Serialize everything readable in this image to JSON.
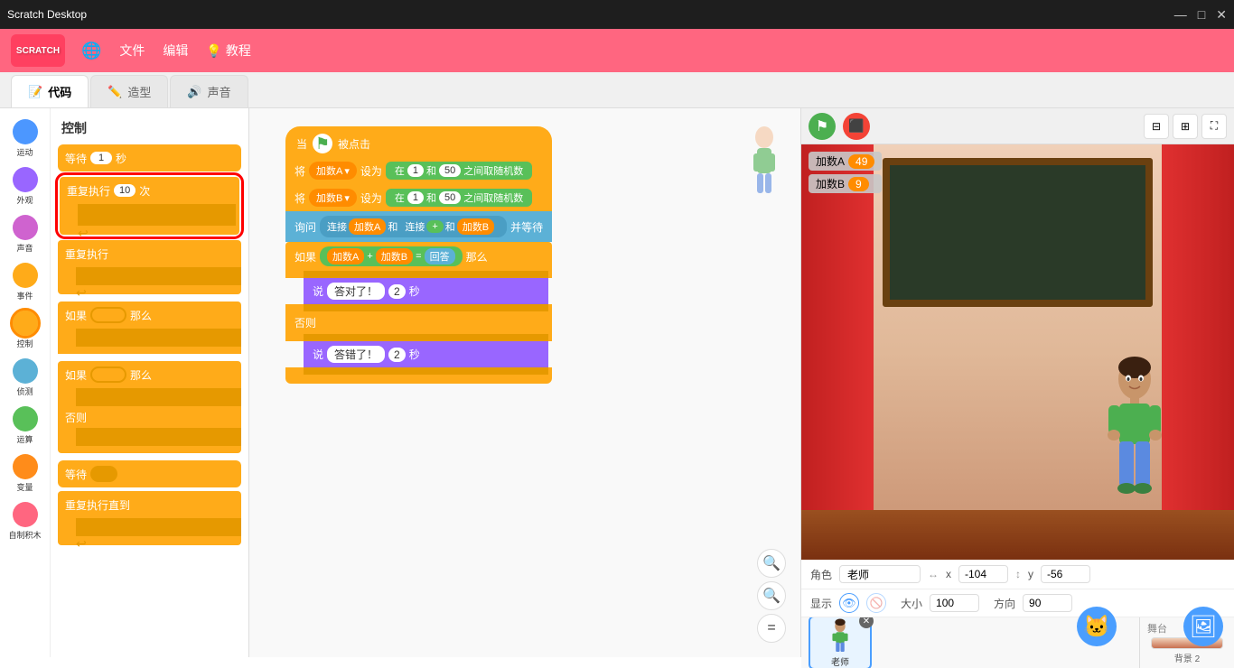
{
  "window": {
    "title": "Scratch Desktop"
  },
  "titlebar": {
    "title": "Scratch Desktop",
    "minimize": "—",
    "maximize": "□",
    "close": "✕"
  },
  "menubar": {
    "logo": "SCRATCH",
    "globe": "🌐",
    "file": "文件",
    "edit": "编辑",
    "tutorial_icon": "💡",
    "tutorial": "教程"
  },
  "tabs": {
    "code": "代码",
    "costume": "造型",
    "sound": "声音"
  },
  "categories": [
    {
      "id": "motion",
      "label": "运动",
      "color": "#4c97ff"
    },
    {
      "id": "looks",
      "label": "外观",
      "color": "#9966ff"
    },
    {
      "id": "sound",
      "label": "声音",
      "color": "#cf63cf"
    },
    {
      "id": "events",
      "label": "事件",
      "color": "#ffab19"
    },
    {
      "id": "control",
      "label": "控制",
      "color": "#ffab19",
      "active": true
    },
    {
      "id": "sensing",
      "label": "侦测",
      "color": "#5cb1d6"
    },
    {
      "id": "operators",
      "label": "运算",
      "color": "#59c059"
    },
    {
      "id": "variables",
      "label": "变量",
      "color": "#ff8c1a"
    },
    {
      "id": "myblocks",
      "label": "自制积木",
      "color": "#ff6680"
    }
  ],
  "blocks_panel": {
    "title": "控制",
    "blocks": [
      {
        "id": "wait",
        "label": "等待",
        "input": "1",
        "unit": "秒",
        "type": "orange"
      },
      {
        "id": "repeat",
        "label": "重复执行",
        "input": "10",
        "unit": "次",
        "type": "orange",
        "circled": true
      },
      {
        "id": "forever",
        "label": "重复执行",
        "type": "orange"
      },
      {
        "id": "if",
        "label": "如果",
        "then": "那么",
        "type": "orange"
      },
      {
        "id": "if_else",
        "label": "如果",
        "then": "那么",
        "else": "否则",
        "type": "orange"
      },
      {
        "id": "wait2",
        "label": "等待",
        "type": "orange"
      },
      {
        "id": "repeat_until",
        "label": "重复执行直到",
        "type": "orange"
      }
    ]
  },
  "script": {
    "hat_label": "当",
    "flag": "🚩",
    "hat_suffix": "被点击",
    "blocks": [
      {
        "type": "set_var",
        "label": "将",
        "var": "加数A",
        "op": "设为",
        "range_prefix": "在",
        "val1": "1",
        "and": "和",
        "val2": "50",
        "range_suffix": "之间取随机数"
      },
      {
        "type": "set_var",
        "label": "将",
        "var": "加数B",
        "op": "设为",
        "range_prefix": "在",
        "val1": "1",
        "and": "和",
        "val2": "50",
        "range_suffix": "之间取随机数"
      },
      {
        "type": "ask",
        "label": "询问",
        "join1": "连接",
        "var1": "加数A",
        "and1": "和",
        "join2": "连接",
        "plus": "+",
        "and2": "和",
        "var2": "加数B",
        "wait": "并等待"
      },
      {
        "type": "if",
        "label": "如果",
        "var1": "加数A",
        "plus": "+",
        "var2": "加数B",
        "eq": "=",
        "answer": "回答",
        "then": "那么",
        "then_block": {
          "label": "说",
          "text": "答对了！",
          "input": "2",
          "unit": "秒"
        },
        "else_label": "否则",
        "else_block": {
          "label": "说",
          "text": "答错了！",
          "input": "2",
          "unit": "秒"
        }
      }
    ]
  },
  "stage": {
    "var_a_label": "加数A",
    "var_a_value": "49",
    "var_b_label": "加数B",
    "var_b_value": "9"
  },
  "info_panel": {
    "sprite_label": "角色",
    "sprite_name": "老师",
    "x_label": "x",
    "x_value": "-104",
    "y_label": "y",
    "y_value": "-56",
    "show_label": "显示",
    "size_label": "大小",
    "size_value": "100",
    "dir_label": "方向",
    "dir_value": "90",
    "sprite_thumb_label": "老师",
    "stage_label": "舞台",
    "bg_count": "背景",
    "bg_number": "2"
  },
  "zoom_controls": {
    "zoom_in": "+",
    "zoom_out": "−",
    "reset": "="
  }
}
